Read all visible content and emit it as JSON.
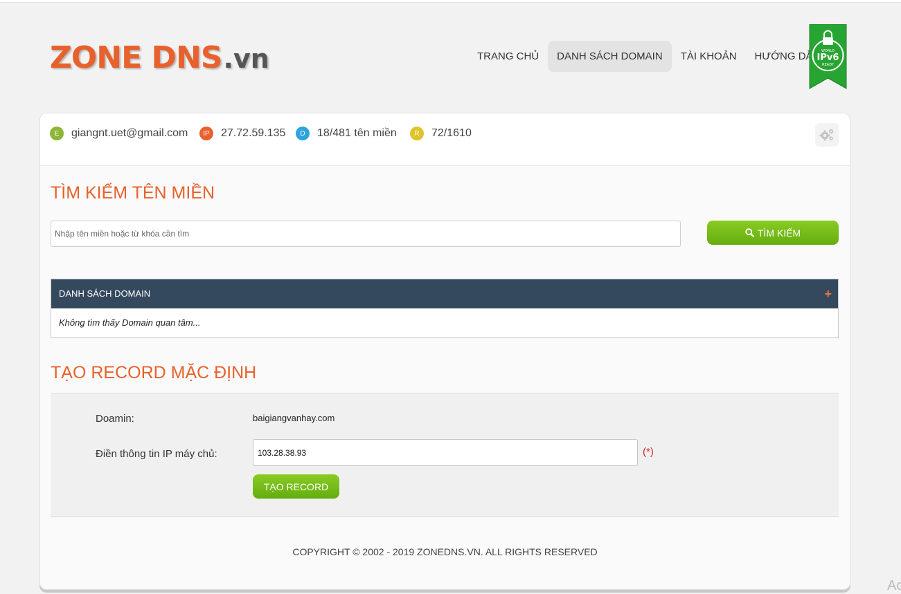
{
  "header": {
    "logo_main": "ZONE DNS",
    "logo_suffix": ".vn",
    "nav": [
      {
        "label": "TRANG CHỦ"
      },
      {
        "label": "DANH SÁCH DOMAIN"
      },
      {
        "label": "TÀI KHOẢN"
      },
      {
        "label": "HƯỚNG DẪN"
      }
    ],
    "badge": {
      "top": "WORLD",
      "main": "IPv6",
      "bottom": "READY"
    }
  },
  "infobar": {
    "email": {
      "badge": "E",
      "value": "giangnt.uet@gmail.com",
      "color": "#8cb636"
    },
    "ip": {
      "badge": "IP",
      "value": "27.72.59.135",
      "color": "#e8612c"
    },
    "domains": {
      "badge": "D",
      "value": "18/481 tên miền",
      "color": "#2ea3dd"
    },
    "records": {
      "badge": "R",
      "value": "72/1610",
      "color": "#e0c32a"
    }
  },
  "search": {
    "title": "TÌM KIẾM TÊN MIỀN",
    "placeholder": "Nhập tên miền hoặc từ khóa cần tìm",
    "button": "TÌM KIẾM"
  },
  "domain_list": {
    "header": "DANH SÁCH DOMAIN",
    "plus": "+",
    "empty_message": "Không tìm thấy Domain quan tâm..."
  },
  "default_record": {
    "title": "TẠO RECORD MẶC ĐỊNH",
    "domain_label": "Doamin:",
    "domain_value": "baigiangvanhay.com",
    "ip_label": "Điền thông tin IP máy chủ:",
    "ip_value": "103.28.38.93",
    "required_mark": "(*)",
    "button": "TẠO RECORD"
  },
  "footer": {
    "copyright": "COPYRIGHT © 2002 - 2019 ZONEDNS.VN. ALL RIGHTS RESERVED"
  },
  "corner_text": "Ac",
  "colors": {
    "accent": "#e8612c",
    "green_button": "#72b817",
    "table_header": "#34495e"
  }
}
